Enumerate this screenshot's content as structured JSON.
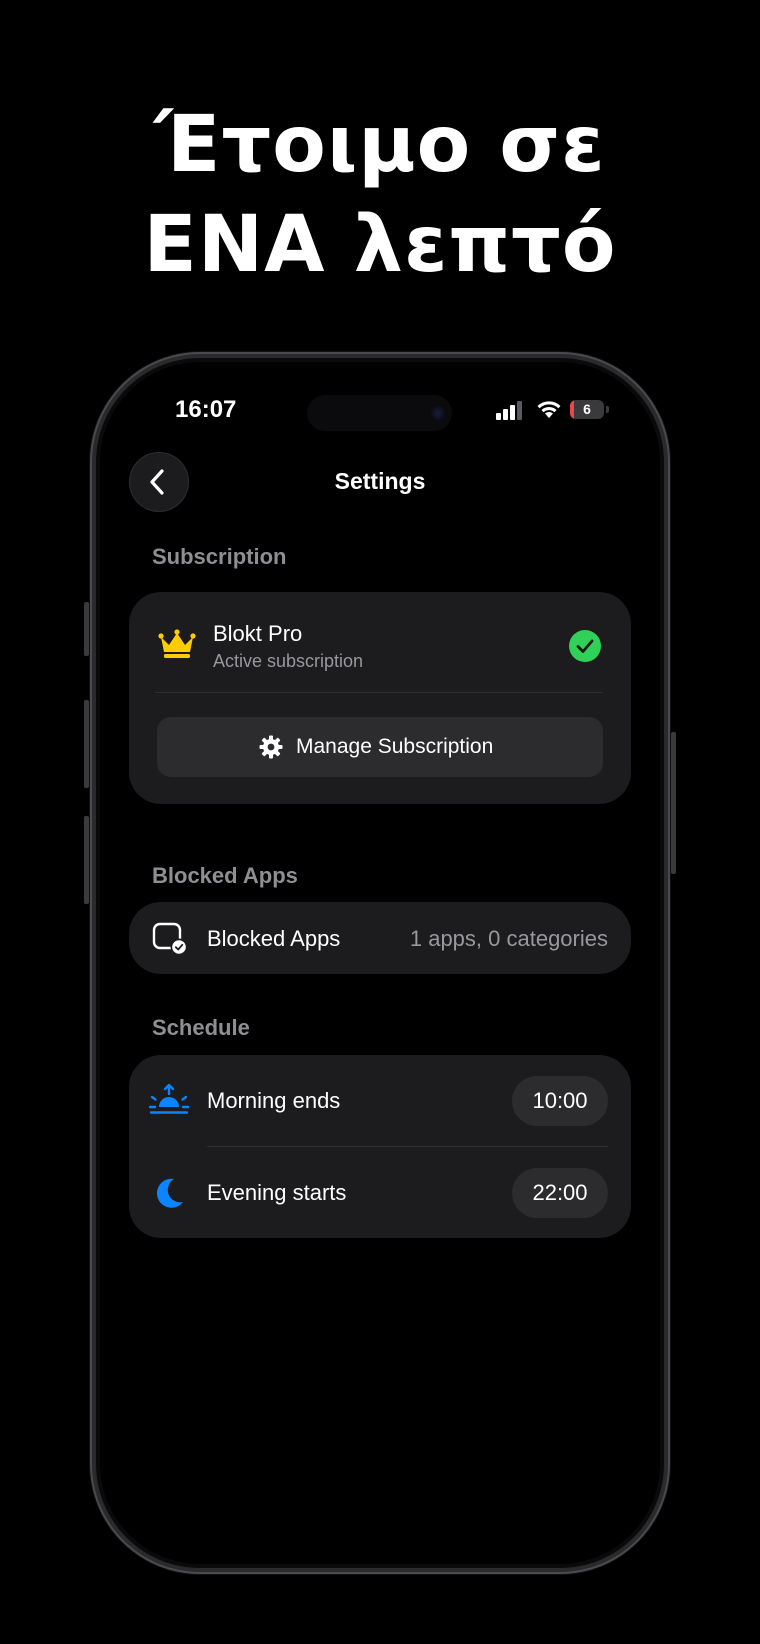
{
  "headline": {
    "line1": "Έτοιμο σε",
    "line2": "ΕΝΑ λεπτό"
  },
  "status_bar": {
    "time": "16:07",
    "battery_level": "6",
    "battery_fraction": 0.06
  },
  "nav": {
    "title": "Settings",
    "back_icon": "chevron-left-icon"
  },
  "subscription": {
    "section_label": "Subscription",
    "plan_name": "Blokt Pro",
    "plan_status": "Active subscription",
    "manage_label": "Manage Subscription"
  },
  "blocked_apps": {
    "section_label": "Blocked Apps",
    "row_label": "Blocked Apps",
    "row_value": "1 apps, 0 categories"
  },
  "schedule": {
    "section_label": "Schedule",
    "items": [
      {
        "label": "Morning ends",
        "time": "10:00",
        "icon": "sunrise-icon"
      },
      {
        "label": "Evening starts",
        "time": "22:00",
        "icon": "moon-icon"
      }
    ]
  },
  "colors": {
    "background": "#000000",
    "card": "#1c1c1e",
    "accent_blue": "#0a84ff",
    "success_green": "#30d158",
    "crown_yellow": "#ffcc00",
    "secondary_text": "#98989d"
  }
}
